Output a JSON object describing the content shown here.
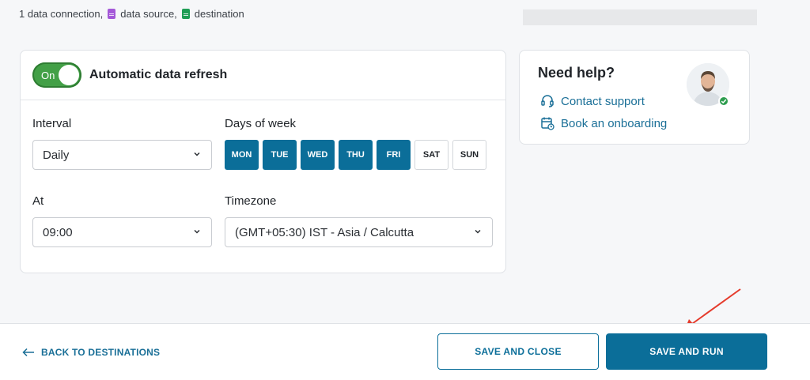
{
  "summary": {
    "text_1": "1 data connection,",
    "text_2": "data source,",
    "text_3": "destination"
  },
  "refresh": {
    "toggle_label": "On",
    "title": "Automatic data refresh",
    "interval_label": "Interval",
    "interval_value": "Daily",
    "days_label": "Days of week",
    "days": [
      {
        "label": "MON",
        "selected": true
      },
      {
        "label": "TUE",
        "selected": true
      },
      {
        "label": "WED",
        "selected": true
      },
      {
        "label": "THU",
        "selected": true
      },
      {
        "label": "FRI",
        "selected": true
      },
      {
        "label": "SAT",
        "selected": false
      },
      {
        "label": "SUN",
        "selected": false
      }
    ],
    "at_label": "At",
    "at_value": "09:00",
    "timezone_label": "Timezone",
    "timezone_value": "(GMT+05:30) IST - Asia / Calcutta"
  },
  "help": {
    "title": "Need help?",
    "contact_label": "Contact support",
    "onboarding_label": "Book an onboarding"
  },
  "footer": {
    "back_label": "BACK TO DESTINATIONS",
    "save_close_label": "SAVE AND CLOSE",
    "save_run_label": "SAVE AND RUN"
  },
  "colors": {
    "primary": "#0b6e99",
    "toggle_on": "#43a047",
    "annotation_arrow": "#e53b2c"
  }
}
